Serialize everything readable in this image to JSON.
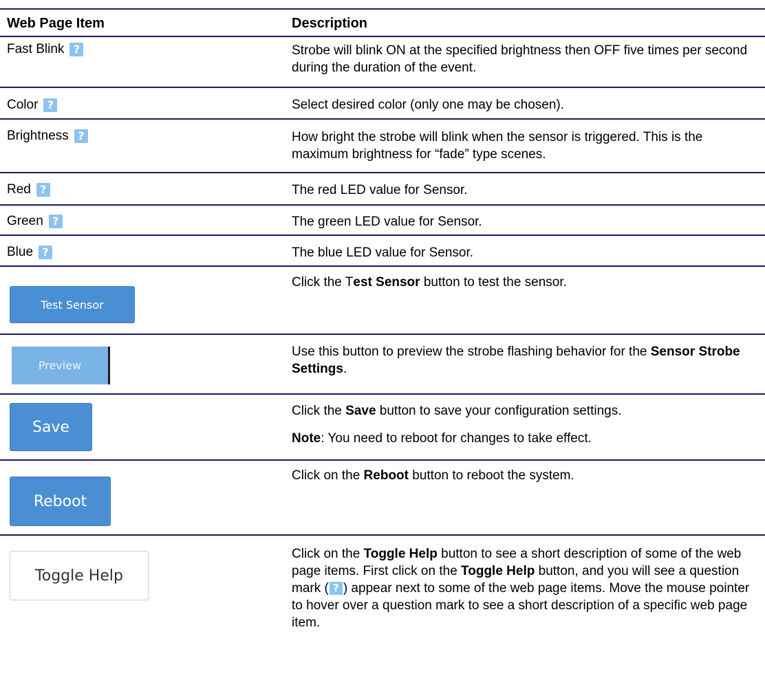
{
  "header": {
    "col_item": "Web Page Item",
    "col_description": "Description"
  },
  "help_icon": {
    "name": "question-mark-icon",
    "glyph": "?",
    "color": "#8cc3f0"
  },
  "rows": [
    {
      "item": "Fast Blink",
      "description": "Strobe will blink ON at the specified brightness then OFF five times per second during the duration of the event."
    },
    {
      "item": "Color",
      "description": "Select desired color (only one may be chosen)."
    },
    {
      "item": "Brightness",
      "description": "How bright the strobe will blink when the sensor is triggered. This is the maximum brightness for “fade” type scenes."
    },
    {
      "item": "Red",
      "description": "The red LED value for Sensor."
    },
    {
      "item": "Green",
      "description": "The green LED value for Sensor."
    },
    {
      "item": "Blue",
      "description": "The blue LED value for Sensor."
    }
  ],
  "test_sensor": {
    "button_label": "Test Sensor",
    "desc_pre": "Click the T",
    "desc_bold": "est Sensor",
    "desc_post": " button to test the sensor."
  },
  "preview": {
    "button_label": "Preview",
    "desc_pre": "Use this button to preview the strobe flashing behavior for the ",
    "desc_bold": "Sensor Strobe Settings",
    "desc_post": "."
  },
  "save": {
    "button_label": "Save",
    "desc_pre": "Click the ",
    "desc_bold": "Save",
    "desc_post": " button to save your configuration settings.",
    "note_label": "Note",
    "note_text": ": You need to reboot for changes to take effect."
  },
  "reboot": {
    "button_label": "Reboot",
    "desc_pre": "Click on the ",
    "desc_bold": "Reboot",
    "desc_post": " button to reboot the system."
  },
  "toggle_help": {
    "button_label": "Toggle Help",
    "desc_1": "Click on the ",
    "desc_bold_1": "Toggle Help",
    "desc_2": " button to see a short description of some of the web page items. First click on the ",
    "desc_bold_2": "Toggle Help",
    "desc_3": " button, and you will see a question mark (",
    "desc_4": ") appear next to some of the web page items. Move the mouse pointer to hover over a question mark to see a short description of a specific web page item."
  }
}
